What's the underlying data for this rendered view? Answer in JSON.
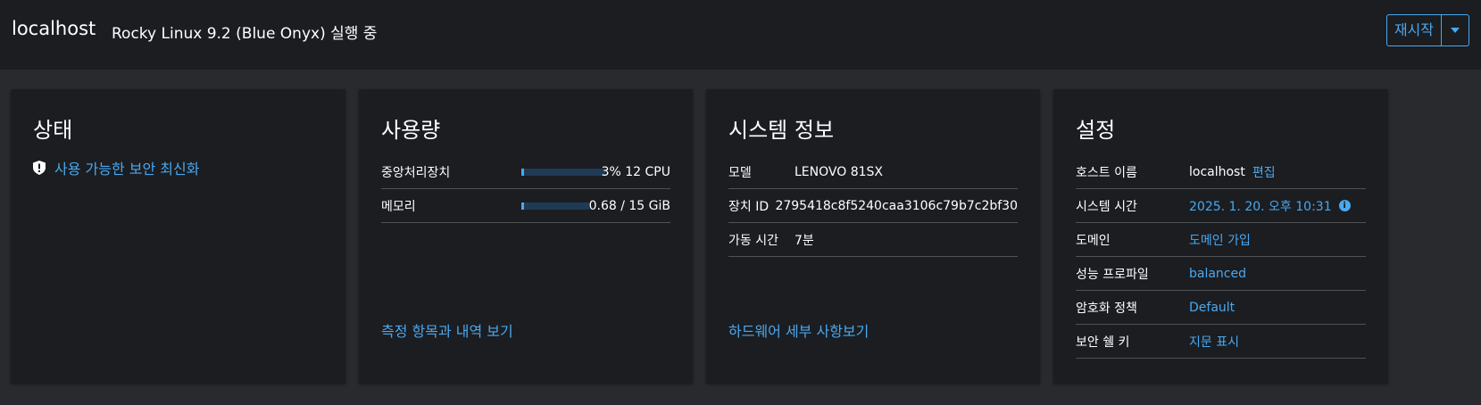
{
  "header": {
    "host": "localhost",
    "os_status": "Rocky Linux 9.2 (Blue Onyx) 실행 중",
    "restart_label": "재시작"
  },
  "status_card": {
    "title": "상태",
    "security_updates": "사용 가능한 보안 최신화"
  },
  "usage_card": {
    "title": "사용량",
    "cpu": {
      "label": "중앙처리장치",
      "value": "3% 12 CPU",
      "fraction": 0.03
    },
    "memory": {
      "label": "메모리",
      "value": "0.68 / 15 GiB",
      "fraction": 0.045
    },
    "metrics_link": "측정 항목과 내역 보기"
  },
  "system_card": {
    "title": "시스템 정보",
    "rows": [
      {
        "label": "모델",
        "value": "LENOVO 81SX"
      },
      {
        "label": "장치 ID",
        "value": "2795418c8f5240caa3106c79b7c2bf30"
      },
      {
        "label": "가동 시간",
        "value": "7분"
      }
    ],
    "hardware_link": "하드웨어 세부 사항보기"
  },
  "config_card": {
    "title": "설정",
    "rows": [
      {
        "label": "호스트 이름",
        "value": "localhost",
        "action": "편집"
      },
      {
        "label": "시스템 시간",
        "value": "2025. 1. 20. 오후 10:31"
      },
      {
        "label": "도메인",
        "value": "도메인 가입"
      },
      {
        "label": "성능 프로파일",
        "value": "balanced"
      },
      {
        "label": "암호화 정책",
        "value": "Default"
      },
      {
        "label": "보안 쉘 키",
        "value": "지문 표시"
      }
    ]
  },
  "colors": {
    "accent": "#4aa8f0",
    "card_bg": "#1b1d21",
    "page_bg": "#292a2e"
  }
}
